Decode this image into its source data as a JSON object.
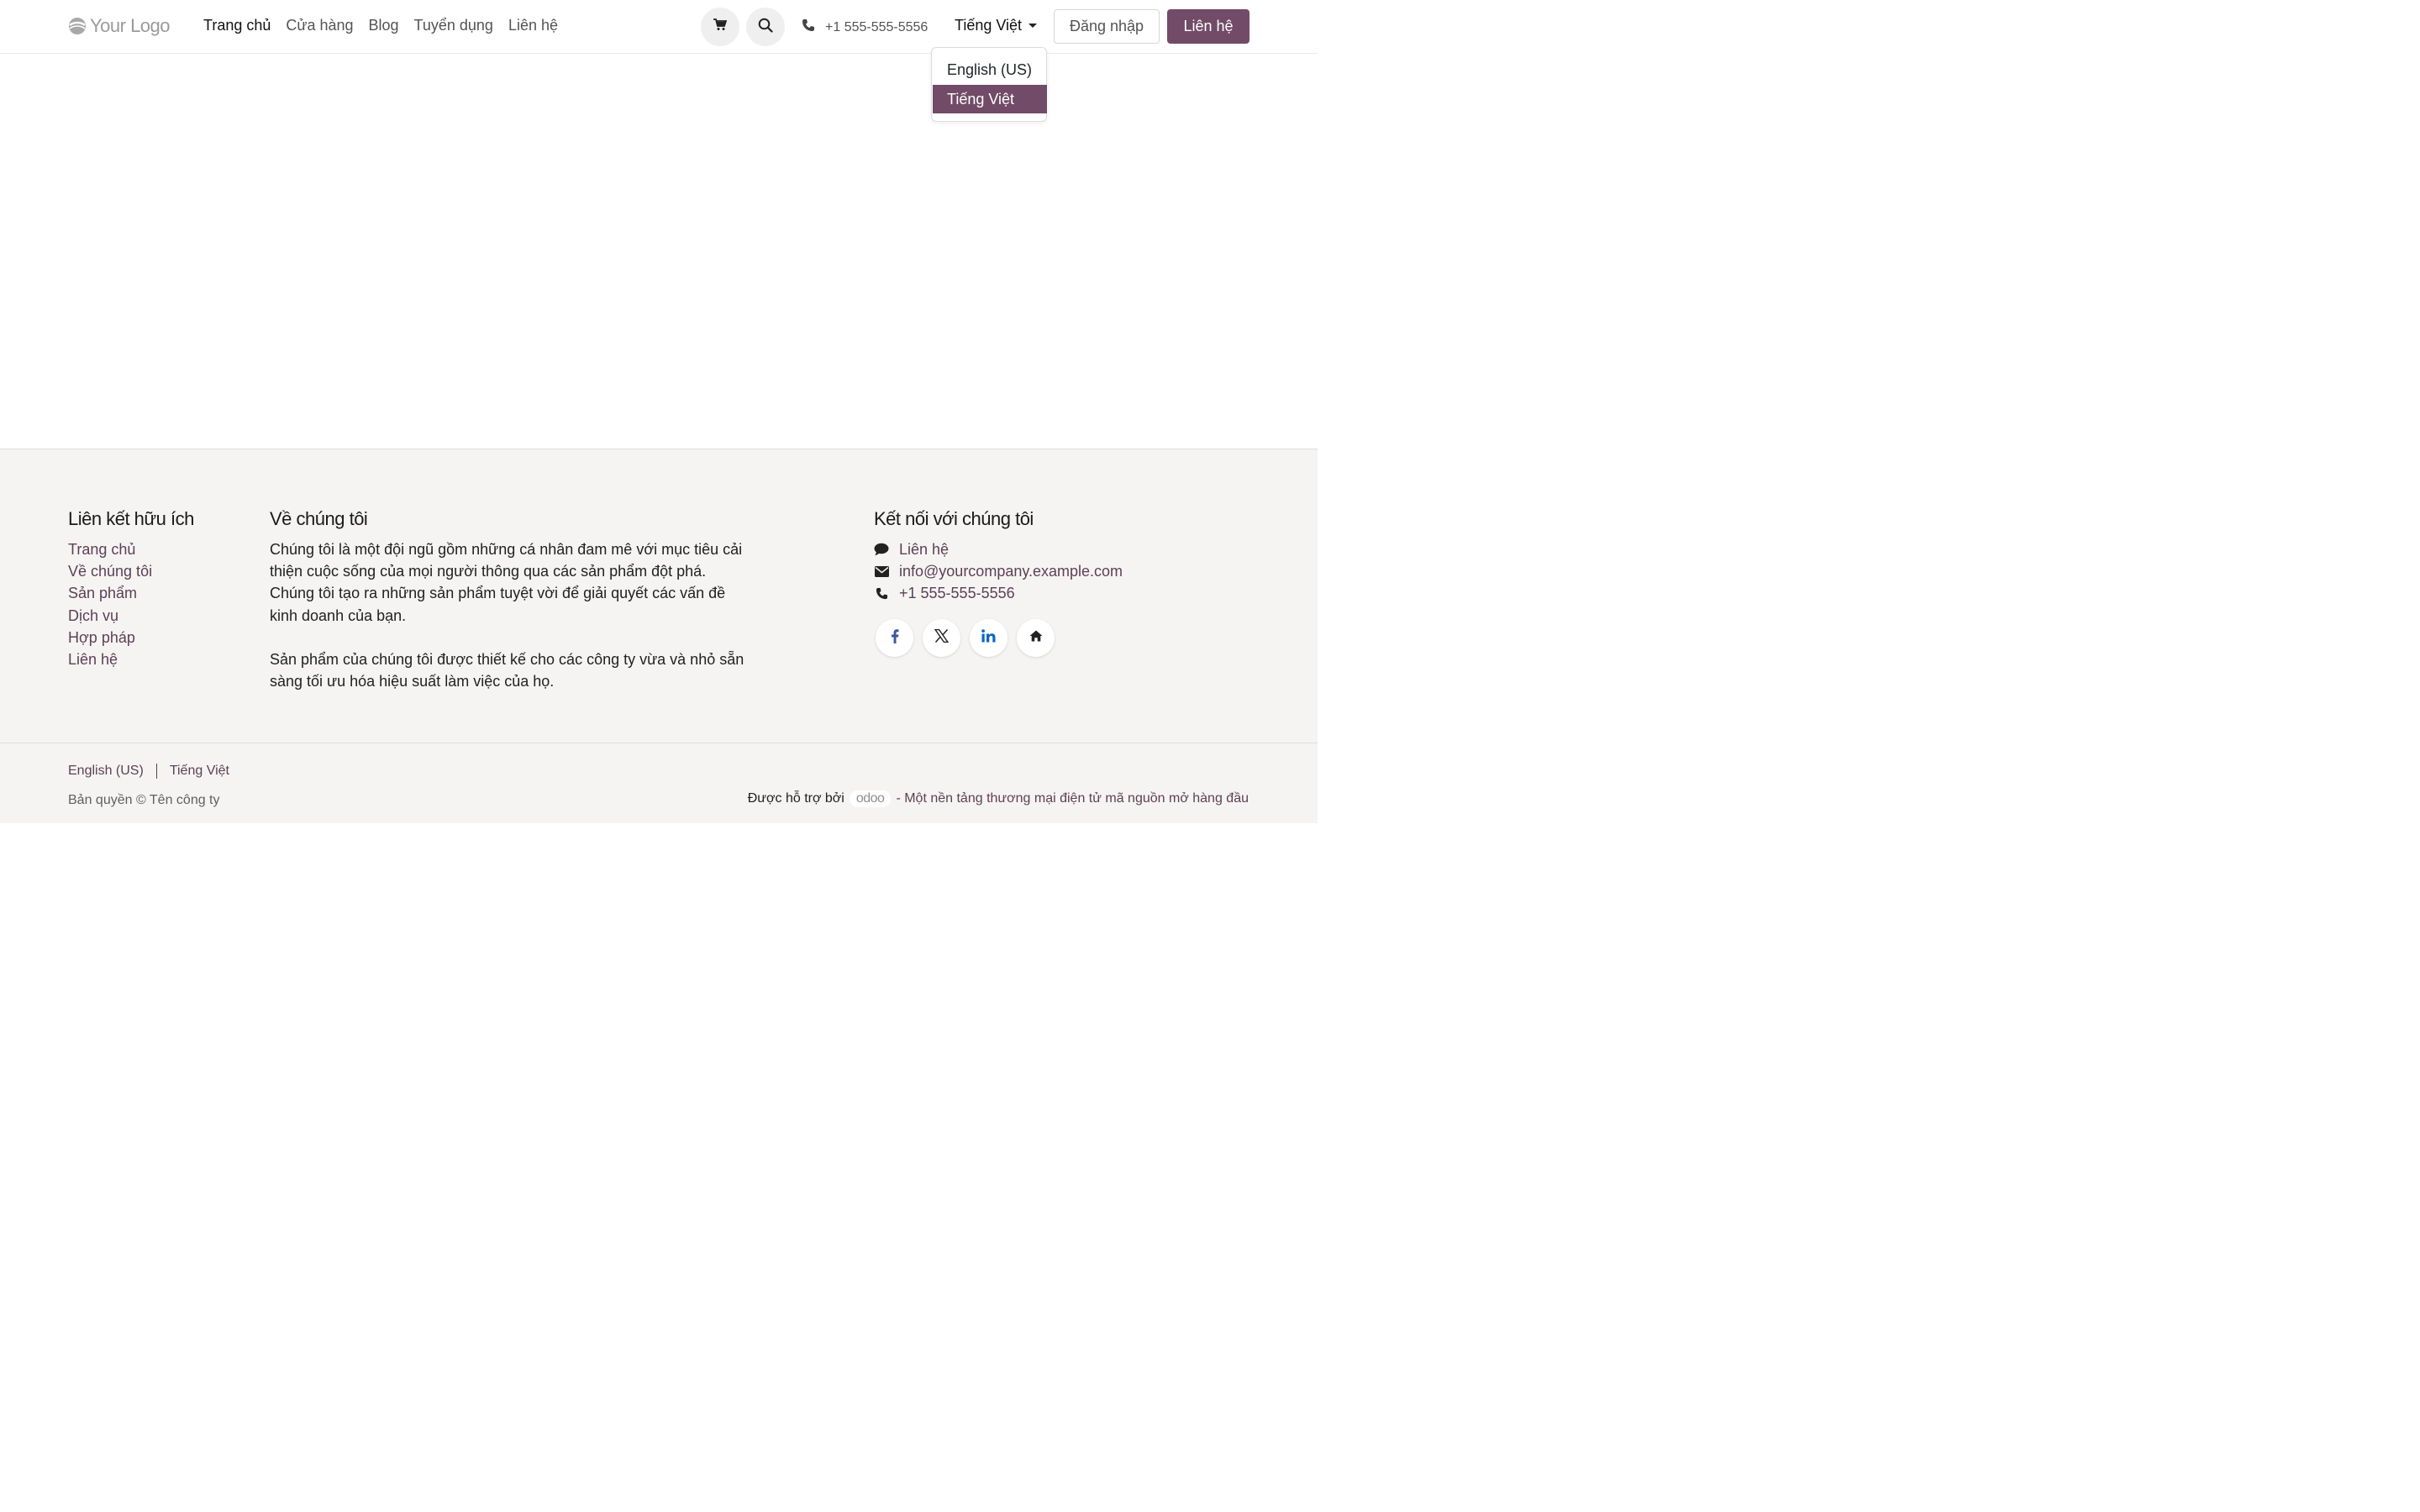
{
  "header": {
    "logo_text": "Your Logo",
    "nav": [
      "Trang chủ",
      "Cửa hàng",
      "Blog",
      "Tuyển dụng",
      "Liên hệ"
    ],
    "icons": {
      "cart": "cart-icon",
      "search": "search-icon",
      "phone": "phone-icon"
    },
    "phone": "+1 555-555-5556",
    "language": "Tiếng Việt",
    "login_label": "Đăng nhập",
    "contact_label": "Liên hệ"
  },
  "language_dropdown": {
    "options": [
      "English (US)",
      "Tiếng Việt"
    ],
    "selected": "Tiếng Việt"
  },
  "footer": {
    "useful_links": {
      "title": "Liên kết hữu ích",
      "items": [
        "Trang chủ",
        "Về chúng tôi",
        "Sản phẩm",
        "Dịch vụ",
        "Hợp pháp",
        "Liên hệ"
      ]
    },
    "about": {
      "title": "Về chúng tôi",
      "p1": "Chúng tôi là một đội ngũ gồm những cá nhân đam mê với mục tiêu cải thiện cuộc sống của mọi người thông qua các sản phẩm đột phá. Chúng tôi tạo ra những sản phẩm tuyệt vời để giải quyết các vấn đề kinh doanh của bạn.",
      "p2": "Sản phẩm của chúng tôi được thiết kế cho các công ty vừa và nhỏ sẵn sàng tối ưu hóa hiệu suất làm việc của họ."
    },
    "connect": {
      "title": "Kết nối với chúng tôi",
      "contact": "Liên hệ",
      "email": "info@yourcompany.example.com",
      "phone": "+1 555-555-5556",
      "socials": [
        "facebook-icon",
        "x-icon",
        "linkedin-icon",
        "home-icon"
      ]
    },
    "languages": [
      "English (US)",
      "Tiếng Việt"
    ],
    "copyright": "Bản quyền © Tên công ty",
    "powered_by": "Được hỗ trợ bởi",
    "odoo": "odoo",
    "tagline": "- Một nền tảng thương mại điện tử mã nguồn mở hàng đầu"
  },
  "colors": {
    "brand": "#714b67",
    "link": "#5e3f57",
    "footer_bg": "#f5f4f2"
  }
}
